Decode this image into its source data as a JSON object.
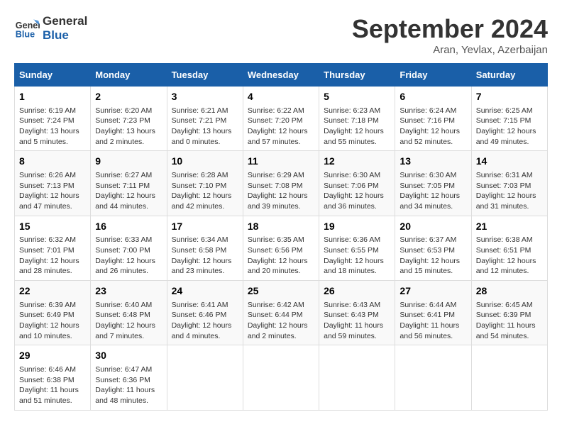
{
  "header": {
    "logo_general": "General",
    "logo_blue": "Blue",
    "month": "September 2024",
    "location": "Aran, Yevlax, Azerbaijan"
  },
  "weekdays": [
    "Sunday",
    "Monday",
    "Tuesday",
    "Wednesday",
    "Thursday",
    "Friday",
    "Saturday"
  ],
  "weeks": [
    [
      {
        "day": "1",
        "info": "Sunrise: 6:19 AM\nSunset: 7:24 PM\nDaylight: 13 hours\nand 5 minutes."
      },
      {
        "day": "2",
        "info": "Sunrise: 6:20 AM\nSunset: 7:23 PM\nDaylight: 13 hours\nand 2 minutes."
      },
      {
        "day": "3",
        "info": "Sunrise: 6:21 AM\nSunset: 7:21 PM\nDaylight: 13 hours\nand 0 minutes."
      },
      {
        "day": "4",
        "info": "Sunrise: 6:22 AM\nSunset: 7:20 PM\nDaylight: 12 hours\nand 57 minutes."
      },
      {
        "day": "5",
        "info": "Sunrise: 6:23 AM\nSunset: 7:18 PM\nDaylight: 12 hours\nand 55 minutes."
      },
      {
        "day": "6",
        "info": "Sunrise: 6:24 AM\nSunset: 7:16 PM\nDaylight: 12 hours\nand 52 minutes."
      },
      {
        "day": "7",
        "info": "Sunrise: 6:25 AM\nSunset: 7:15 PM\nDaylight: 12 hours\nand 49 minutes."
      }
    ],
    [
      {
        "day": "8",
        "info": "Sunrise: 6:26 AM\nSunset: 7:13 PM\nDaylight: 12 hours\nand 47 minutes."
      },
      {
        "day": "9",
        "info": "Sunrise: 6:27 AM\nSunset: 7:11 PM\nDaylight: 12 hours\nand 44 minutes."
      },
      {
        "day": "10",
        "info": "Sunrise: 6:28 AM\nSunset: 7:10 PM\nDaylight: 12 hours\nand 42 minutes."
      },
      {
        "day": "11",
        "info": "Sunrise: 6:29 AM\nSunset: 7:08 PM\nDaylight: 12 hours\nand 39 minutes."
      },
      {
        "day": "12",
        "info": "Sunrise: 6:30 AM\nSunset: 7:06 PM\nDaylight: 12 hours\nand 36 minutes."
      },
      {
        "day": "13",
        "info": "Sunrise: 6:30 AM\nSunset: 7:05 PM\nDaylight: 12 hours\nand 34 minutes."
      },
      {
        "day": "14",
        "info": "Sunrise: 6:31 AM\nSunset: 7:03 PM\nDaylight: 12 hours\nand 31 minutes."
      }
    ],
    [
      {
        "day": "15",
        "info": "Sunrise: 6:32 AM\nSunset: 7:01 PM\nDaylight: 12 hours\nand 28 minutes."
      },
      {
        "day": "16",
        "info": "Sunrise: 6:33 AM\nSunset: 7:00 PM\nDaylight: 12 hours\nand 26 minutes."
      },
      {
        "day": "17",
        "info": "Sunrise: 6:34 AM\nSunset: 6:58 PM\nDaylight: 12 hours\nand 23 minutes."
      },
      {
        "day": "18",
        "info": "Sunrise: 6:35 AM\nSunset: 6:56 PM\nDaylight: 12 hours\nand 20 minutes."
      },
      {
        "day": "19",
        "info": "Sunrise: 6:36 AM\nSunset: 6:55 PM\nDaylight: 12 hours\nand 18 minutes."
      },
      {
        "day": "20",
        "info": "Sunrise: 6:37 AM\nSunset: 6:53 PM\nDaylight: 12 hours\nand 15 minutes."
      },
      {
        "day": "21",
        "info": "Sunrise: 6:38 AM\nSunset: 6:51 PM\nDaylight: 12 hours\nand 12 minutes."
      }
    ],
    [
      {
        "day": "22",
        "info": "Sunrise: 6:39 AM\nSunset: 6:49 PM\nDaylight: 12 hours\nand 10 minutes."
      },
      {
        "day": "23",
        "info": "Sunrise: 6:40 AM\nSunset: 6:48 PM\nDaylight: 12 hours\nand 7 minutes."
      },
      {
        "day": "24",
        "info": "Sunrise: 6:41 AM\nSunset: 6:46 PM\nDaylight: 12 hours\nand 4 minutes."
      },
      {
        "day": "25",
        "info": "Sunrise: 6:42 AM\nSunset: 6:44 PM\nDaylight: 12 hours\nand 2 minutes."
      },
      {
        "day": "26",
        "info": "Sunrise: 6:43 AM\nSunset: 6:43 PM\nDaylight: 11 hours\nand 59 minutes."
      },
      {
        "day": "27",
        "info": "Sunrise: 6:44 AM\nSunset: 6:41 PM\nDaylight: 11 hours\nand 56 minutes."
      },
      {
        "day": "28",
        "info": "Sunrise: 6:45 AM\nSunset: 6:39 PM\nDaylight: 11 hours\nand 54 minutes."
      }
    ],
    [
      {
        "day": "29",
        "info": "Sunrise: 6:46 AM\nSunset: 6:38 PM\nDaylight: 11 hours\nand 51 minutes."
      },
      {
        "day": "30",
        "info": "Sunrise: 6:47 AM\nSunset: 6:36 PM\nDaylight: 11 hours\nand 48 minutes."
      },
      {
        "day": "",
        "info": ""
      },
      {
        "day": "",
        "info": ""
      },
      {
        "day": "",
        "info": ""
      },
      {
        "day": "",
        "info": ""
      },
      {
        "day": "",
        "info": ""
      }
    ]
  ]
}
